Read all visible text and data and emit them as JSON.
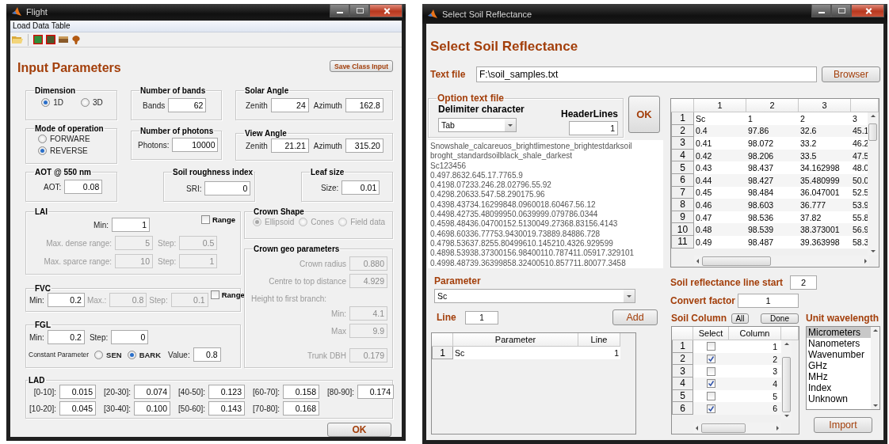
{
  "flight": {
    "title": "Flight",
    "menu": [
      "Load Data Table"
    ],
    "heading": "Input Parameters",
    "save_button": "Save Class Input",
    "dimension": {
      "title": "Dimension",
      "options": [
        {
          "label": "1D",
          "selected": true
        },
        {
          "label": "3D",
          "selected": false
        }
      ]
    },
    "bands": {
      "title": "Number of bands",
      "label": "Bands",
      "value": "62"
    },
    "solar_angle": {
      "title": "Solar Angle",
      "fields": [
        {
          "label": "Zenith",
          "value": "24"
        },
        {
          "label": "Azimuth",
          "value": "162.8"
        }
      ]
    },
    "mode": {
      "title": "Mode of operation",
      "options": [
        {
          "label": "FORWARE",
          "selected": false
        },
        {
          "label": "REVERSE",
          "selected": true
        }
      ]
    },
    "photons": {
      "title": "Number of photons",
      "label": "Photons:",
      "value": "10000"
    },
    "view_angle": {
      "title": "View Angle",
      "fields": [
        {
          "label": "Zenith",
          "value": "21.21"
        },
        {
          "label": "Azimuth",
          "value": "315.20"
        }
      ]
    },
    "aot": {
      "title": "AOT @ 550 nm",
      "label": "AOT:",
      "value": "0.08"
    },
    "sri": {
      "title": "Soil roughness index",
      "label": "SRI:",
      "value": "0"
    },
    "leaf_size": {
      "title": "Leaf size",
      "label": "Size:",
      "value": "0.01"
    },
    "lai": {
      "title": "LAI",
      "range": {
        "label": "Range",
        "checked": false
      },
      "min": {
        "label": "Min:",
        "value": "1",
        "disabled": false
      },
      "rows": [
        [
          {
            "label": "Max. dense range:",
            "value": "5",
            "disabled": true
          },
          {
            "label": "Step:",
            "value": "0.5",
            "disabled": true
          }
        ],
        [
          {
            "label": "Max. sparce range:",
            "value": "10",
            "disabled": true
          },
          {
            "label": "Step:",
            "value": "1",
            "disabled": true
          }
        ]
      ]
    },
    "fvc": {
      "title": "FVC",
      "fields": [
        {
          "label": "Min:",
          "value": "0.2",
          "disabled": false
        },
        {
          "label": "Max.:",
          "value": "0.8",
          "disabled": true
        },
        {
          "label": "Step:",
          "value": "0.1",
          "disabled": true
        }
      ],
      "range": {
        "label": "Range",
        "checked": false
      }
    },
    "fgl": {
      "title": "FGL",
      "fields": [
        {
          "label": "Min:",
          "value": "0.2",
          "disabled": false
        },
        {
          "label": "Step:",
          "value": "0",
          "disabled": false
        }
      ],
      "constant_label": "Constant Parameter",
      "options": [
        {
          "label": "SEN",
          "selected": false
        },
        {
          "label": "BARK",
          "selected": true
        }
      ],
      "value_field": {
        "label": "Value:",
        "value": "0.8",
        "disabled": false
      }
    },
    "crown_shape": {
      "title": "Crown Shape",
      "disabled": true,
      "options": [
        {
          "label": "Ellipsoid",
          "selected": true
        },
        {
          "label": "Cones",
          "selected": false
        },
        {
          "label": "Field data",
          "selected": false
        }
      ]
    },
    "crown_geo": {
      "title": "Crown geo parameters",
      "items": [
        {
          "kind": "field",
          "label": "Crown radius",
          "value": "0.880",
          "disabled": true
        },
        {
          "kind": "field",
          "label": "Centre to top distance",
          "value": "4.929",
          "disabled": true
        },
        {
          "kind": "note",
          "label": "Height to first branch:"
        },
        {
          "kind": "field",
          "label": "Min:",
          "value": "4.1",
          "disabled": true
        },
        {
          "kind": "field",
          "label": "Max",
          "value": "9.9",
          "disabled": true
        },
        {
          "kind": "field",
          "label": "Trunk DBH",
          "value": "0.179",
          "disabled": true
        }
      ]
    },
    "lad": {
      "title": "LAD",
      "rows": [
        [
          {
            "label": "[0-10]:",
            "value": "0.015"
          },
          {
            "label": "[20-30]:",
            "value": "0.074"
          },
          {
            "label": "[40-50]:",
            "value": "0.123"
          },
          {
            "label": "[60-70]:",
            "value": "0.158"
          },
          {
            "label": "[80-90]:",
            "value": "0.174"
          }
        ],
        [
          {
            "label": "[10-20]:",
            "value": "0.045"
          },
          {
            "label": "[30-40]:",
            "value": "0.100"
          },
          {
            "label": "[50-60]:",
            "value": "0.143"
          },
          {
            "label": "[70-80]:",
            "value": "0.168"
          }
        ]
      ]
    },
    "ok_button": "OK"
  },
  "soil": {
    "title": "Select Soil Reflectance",
    "heading": "Select Soil Reflectance",
    "text_file": {
      "label": "Text file",
      "value": "F:\\soil_samples.txt"
    },
    "browse_button": "Browser",
    "options": {
      "title": "Option text file",
      "delimiter_label": "Delimiter character",
      "delimiter": "Tab",
      "header_label": "HeaderLines",
      "header": "1"
    },
    "ok_button": "OK",
    "preview": [
      "Snowshale_calcareuos_brightlimestone_brightestdarksoil",
      "broght_standardsoilblack_shale_darkest",
      "Sc123456",
      "0.497.8632.645.17.7765.9",
      "0.4198.07233.246.28.02796.55.92",
      "0.4298.20633.547.58.290175.96",
      "0.4398.43734.16299848.0960018.60467.56.12",
      "0.4498.42735.48099950.0639999.079786.0344",
      "0.4598.48436.04700152.5130049.27368.83156.4143",
      "0.4698.60336.77753.9430019.73889.84886.728",
      "0.4798.53637.8255.80499610.145210.4326.929599",
      "0.4898.53938.37300156.98400110.787411.05917.329101",
      "0.4998.48739.36399858.32400510.857711.80077.3458"
    ],
    "data_table": {
      "columns": [
        "1",
        "2",
        "3"
      ],
      "rows": [
        {
          "header": "1",
          "cells": [
            "Sc",
            "1",
            "2",
            "3"
          ]
        },
        {
          "header": "2",
          "cells": [
            "0.4",
            "97.86",
            "32.6",
            "45.1"
          ]
        },
        {
          "header": "3",
          "cells": [
            "0.41",
            "98.072",
            "33.2",
            "46.2"
          ]
        },
        {
          "header": "4",
          "cells": [
            "0.42",
            "98.206",
            "33.5",
            "47.5"
          ]
        },
        {
          "header": "5",
          "cells": [
            "0.43",
            "98.437",
            "34.162998",
            "48.0"
          ]
        },
        {
          "header": "6",
          "cells": [
            "0.44",
            "98.427",
            "35.480999",
            "50.0"
          ]
        },
        {
          "header": "7",
          "cells": [
            "0.45",
            "98.484",
            "36.047001",
            "52.5"
          ]
        },
        {
          "header": "8",
          "cells": [
            "0.46",
            "98.603",
            "36.777",
            "53.9"
          ]
        },
        {
          "header": "9",
          "cells": [
            "0.47",
            "98.536",
            "37.82",
            "55.8"
          ]
        },
        {
          "header": "10",
          "cells": [
            "0.48",
            "98.539",
            "38.373001",
            "56.9"
          ]
        },
        {
          "header": "11",
          "cells": [
            "0.49",
            "98.487",
            "39.363998",
            "58.3"
          ]
        }
      ]
    },
    "parameter": {
      "label": "Parameter",
      "value": "Sc"
    },
    "line": {
      "label": "Line",
      "value": "1"
    },
    "add_button": "Add",
    "param_table": {
      "columns": [
        "Parameter",
        "Line"
      ],
      "rows": [
        {
          "header": "1",
          "cells": [
            "Sc",
            "1"
          ]
        }
      ]
    },
    "line_start": {
      "label": "Soil reflectance line start",
      "value": "2"
    },
    "convert": {
      "label": "Convert factor",
      "value": "1"
    },
    "soil_column": {
      "label": "Soil Column",
      "buttons": [
        "All",
        "Done"
      ],
      "columns": [
        "Select",
        "Column"
      ],
      "rows": [
        {
          "header": "1",
          "checked": false,
          "value": "1"
        },
        {
          "header": "2",
          "checked": true,
          "value": "2"
        },
        {
          "header": "3",
          "checked": false,
          "value": "3"
        },
        {
          "header": "4",
          "checked": true,
          "value": "4"
        },
        {
          "header": "5",
          "checked": false,
          "value": "5"
        },
        {
          "header": "6",
          "checked": true,
          "value": "6"
        }
      ]
    },
    "unit": {
      "label": "Unit wavelength",
      "items": [
        {
          "label": "Micrometers",
          "selected": true
        },
        {
          "label": "Nanometers",
          "selected": false
        },
        {
          "label": "Wavenumber",
          "selected": false
        },
        {
          "label": "GHz",
          "selected": false
        },
        {
          "label": "MHz",
          "selected": false
        },
        {
          "label": "Index",
          "selected": false
        },
        {
          "label": "Unknown",
          "selected": false
        }
      ]
    },
    "import_button": "Import"
  }
}
